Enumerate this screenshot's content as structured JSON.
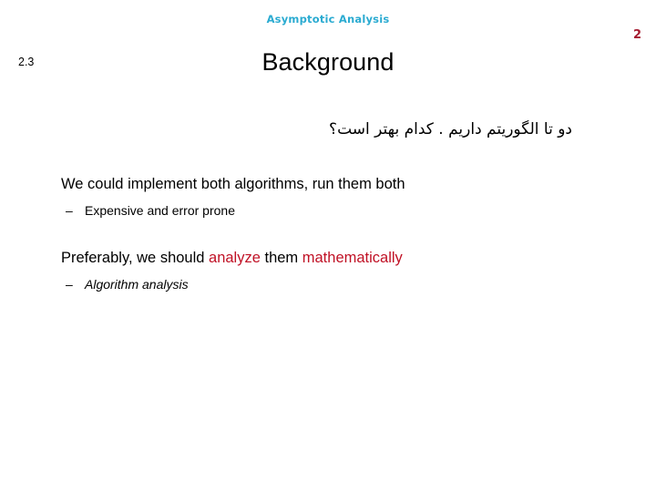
{
  "slide": {
    "header": "Asymptotic Analysis",
    "page_number": "2",
    "section_number": "2.3",
    "title": "Background",
    "rtl_text": "دو تا الگوریتم داریم . کدام بهتر است؟",
    "bullets": {
      "b1": "We could implement both algorithms, run them both",
      "b1_sub_dash": "–",
      "b1_sub": "Expensive and error prone",
      "b2_part1": "Preferably, we should ",
      "b2_hl1": "analyze",
      "b2_part2": " them ",
      "b2_hl2": "mathematically",
      "b2_sub_dash": "–",
      "b2_sub": "Algorithm analysis"
    }
  },
  "colors": {
    "header_teal": "#2BABD1",
    "page_number_red": "#A51C30",
    "highlight_red": "#C01125",
    "text_black": "#000000",
    "background": "#ffffff"
  }
}
